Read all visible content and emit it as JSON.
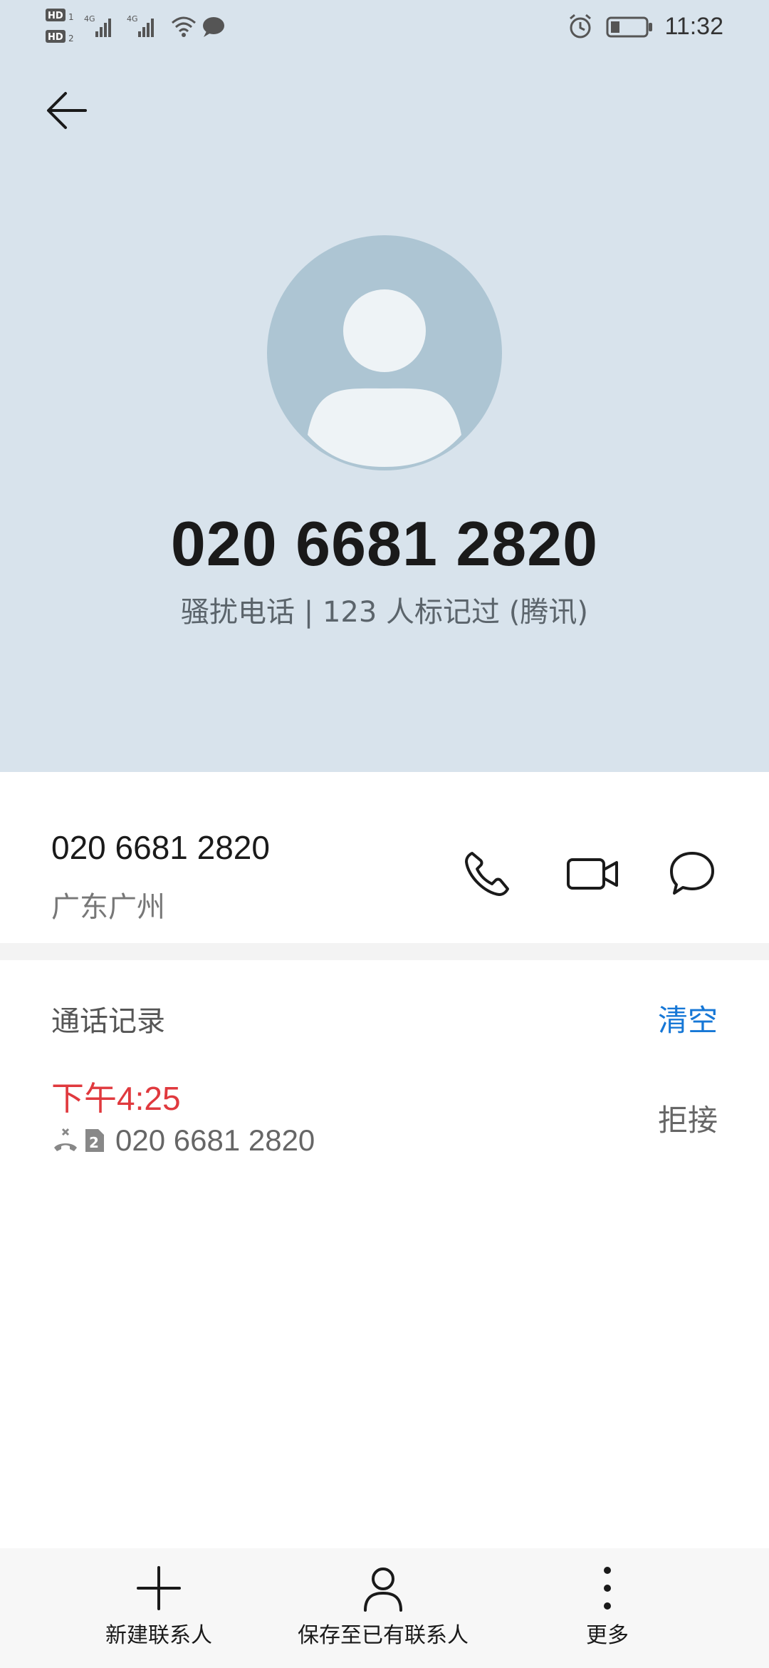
{
  "status_bar": {
    "time": "11:32",
    "left_icons": [
      "hd-sim1-icon",
      "hd-sim2-icon",
      "4g-signal-icon",
      "4g-signal-icon",
      "wifi-icon",
      "message-icon"
    ],
    "right_icons": [
      "alarm-icon",
      "battery-icon"
    ]
  },
  "header": {
    "back_icon": "arrow-left-icon",
    "avatar_icon": "person-placeholder-icon",
    "number": "020 6681 2820",
    "subtitle": "骚扰电话 | 123 人标记过 (腾讯)"
  },
  "number_row": {
    "number": "020 6681 2820",
    "location": "广东广州",
    "actions": [
      {
        "icon": "phone-icon",
        "name": "call"
      },
      {
        "icon": "video-camera-icon",
        "name": "video-call"
      },
      {
        "icon": "message-bubble-icon",
        "name": "message"
      }
    ]
  },
  "call_log": {
    "title": "通话记录",
    "clear_label": "清空",
    "entries": [
      {
        "time": "下午4:25",
        "number": "020 6681 2820",
        "status": "拒接",
        "sim": "2"
      }
    ]
  },
  "bottom_bar": {
    "items": [
      {
        "label": "新建联系人",
        "icon": "plus-icon"
      },
      {
        "label": "保存至已有联系人",
        "icon": "person-icon"
      },
      {
        "label": "更多",
        "icon": "more-vertical-icon"
      }
    ]
  },
  "colors": {
    "hero_bg": "#d8e3ec",
    "avatar_bg": "#adc5d3",
    "accent_blue": "#1677d6",
    "missed_red": "#e0393e"
  }
}
